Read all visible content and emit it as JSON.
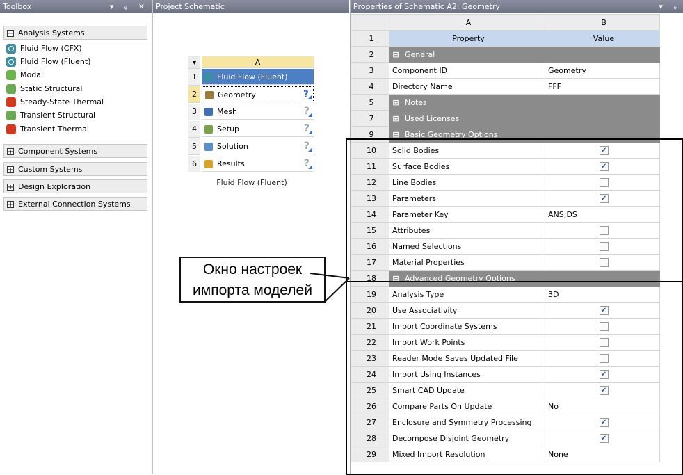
{
  "toolbox": {
    "title": "Toolbox",
    "controls": "▾ ᵩ ✕",
    "analysis_group": "Analysis Systems",
    "items": [
      "Fluid Flow (CFX)",
      "Fluid Flow (Fluent)",
      "Modal",
      "Static Structural",
      "Steady-State Thermal",
      "Transient Structural",
      "Transient Thermal"
    ],
    "groups": [
      "Component Systems",
      "Custom Systems",
      "Design Exploration",
      "External Connection Systems"
    ]
  },
  "schematic": {
    "title": "Project Schematic",
    "col": "A",
    "rows": [
      {
        "n": "1",
        "label": "Fluid Flow (Fluent)"
      },
      {
        "n": "2",
        "label": "Geometry"
      },
      {
        "n": "3",
        "label": "Mesh"
      },
      {
        "n": "4",
        "label": "Setup"
      },
      {
        "n": "5",
        "label": "Solution"
      },
      {
        "n": "6",
        "label": "Results"
      }
    ],
    "caption": "Fluid Flow (Fluent)"
  },
  "annotation": {
    "line1": "Окно настроек",
    "line2": "импорта моделей"
  },
  "properties": {
    "title": "Properties of Schematic A2: Geometry",
    "controls": "▾ ᵩ",
    "col_a": "A",
    "col_b": "B",
    "rows": [
      {
        "n": "1",
        "type": "header",
        "a": "Property",
        "b": "Value"
      },
      {
        "n": "2",
        "type": "cat",
        "sign": "−",
        "a": "General"
      },
      {
        "n": "3",
        "type": "text",
        "a": "Component ID",
        "b": "Geometry"
      },
      {
        "n": "4",
        "type": "text",
        "a": "Directory Name",
        "b": "FFF"
      },
      {
        "n": "5",
        "type": "cat",
        "sign": "+",
        "a": "Notes"
      },
      {
        "n": "7",
        "type": "cat",
        "sign": "+",
        "a": "Used Licenses"
      },
      {
        "n": "9",
        "type": "cat",
        "sign": "−",
        "a": "Basic Geometry Options"
      },
      {
        "n": "10",
        "type": "check",
        "a": "Solid Bodies",
        "checked": true
      },
      {
        "n": "11",
        "type": "check",
        "a": "Surface Bodies",
        "checked": true
      },
      {
        "n": "12",
        "type": "check",
        "a": "Line Bodies",
        "checked": false
      },
      {
        "n": "13",
        "type": "check",
        "a": "Parameters",
        "checked": true
      },
      {
        "n": "14",
        "type": "text",
        "a": "Parameter Key",
        "b": "ANS;DS"
      },
      {
        "n": "15",
        "type": "check",
        "a": "Attributes",
        "checked": false
      },
      {
        "n": "16",
        "type": "check",
        "a": "Named Selections",
        "checked": false
      },
      {
        "n": "17",
        "type": "check",
        "a": "Material Properties",
        "checked": false
      },
      {
        "n": "18",
        "type": "cat",
        "sign": "−",
        "a": "Advanced Geometry Options"
      },
      {
        "n": "19",
        "type": "text",
        "a": "Analysis Type",
        "b": "3D"
      },
      {
        "n": "20",
        "type": "check",
        "a": "Use Associativity",
        "checked": true
      },
      {
        "n": "21",
        "type": "check",
        "a": "Import Coordinate Systems",
        "checked": false
      },
      {
        "n": "22",
        "type": "check",
        "a": "Import Work Points",
        "checked": false
      },
      {
        "n": "23",
        "type": "check",
        "a": "Reader Mode Saves Updated File",
        "checked": false
      },
      {
        "n": "24",
        "type": "check",
        "a": "Import Using Instances",
        "checked": true
      },
      {
        "n": "25",
        "type": "check",
        "a": "Smart CAD Update",
        "checked": true
      },
      {
        "n": "26",
        "type": "text",
        "a": "Compare Parts On Update",
        "b": "No"
      },
      {
        "n": "27",
        "type": "check",
        "a": "Enclosure and Symmetry Processing",
        "checked": true
      },
      {
        "n": "28",
        "type": "check",
        "a": "Decompose Disjoint Geometry",
        "checked": true
      },
      {
        "n": "29",
        "type": "text",
        "a": "Mixed Import Resolution",
        "b": "None"
      }
    ]
  }
}
